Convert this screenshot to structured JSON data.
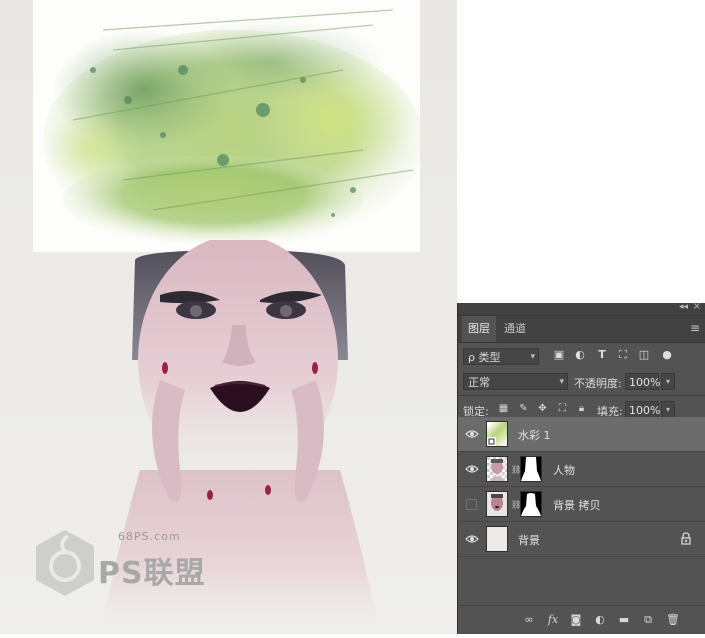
{
  "canvas": {
    "watermark_site": "68PS.com",
    "watermark_brand": "PS联盟"
  },
  "panel": {
    "tabs": [
      {
        "label": "图层",
        "active": true
      },
      {
        "label": "通道",
        "active": false
      }
    ],
    "filter": {
      "label": "ρ 类型"
    },
    "blend_mode": "正常",
    "opacity_label": "不透明度:",
    "opacity_value": "100%",
    "lock_label": "锁定:",
    "fill_label": "填充:",
    "fill_value": "100%",
    "layers": [
      {
        "name": "水彩 1",
        "visible": true,
        "selected": true
      },
      {
        "name": "人物",
        "visible": true,
        "selected": false
      },
      {
        "name": "背景 拷贝",
        "visible": false,
        "selected": false
      },
      {
        "name": "背景",
        "visible": true,
        "selected": false,
        "locked": true
      }
    ],
    "bottom_icons": [
      "link-icon",
      "fx-icon",
      "mask-icon",
      "adjustment-icon",
      "folder-icon",
      "new-layer-icon",
      "trash-icon"
    ]
  },
  "colors": {
    "panel_bg": "#535353",
    "selected_row": "#6c6c6c",
    "canvas_bg": "#ebeae6"
  }
}
